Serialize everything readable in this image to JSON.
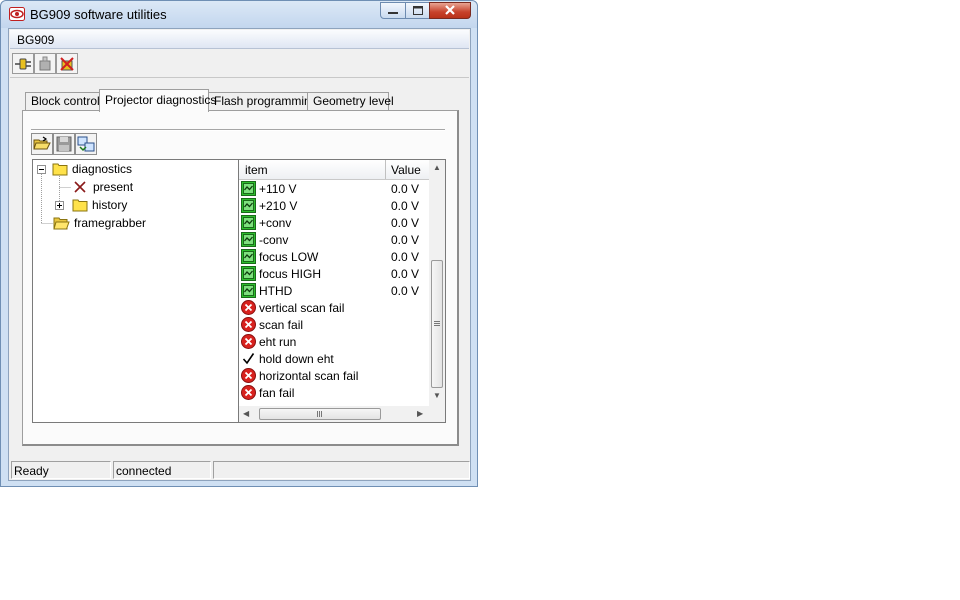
{
  "window": {
    "title": "BG909 software utilities",
    "doc_title": "BG909",
    "colors": {
      "title_gradient_top": "#dbe8f6",
      "close_button": "#c7422b",
      "folder": "#ffe24a",
      "status_ok": "#2dbd2d",
      "status_fail": "#d8221e"
    }
  },
  "toolbar": {
    "buttons": [
      {
        "icon": "connect-plug-icon"
      },
      {
        "icon": "device-disabled-icon"
      },
      {
        "icon": "device-delete-icon"
      }
    ]
  },
  "tabs": [
    {
      "label": "Block control",
      "active": false
    },
    {
      "label": "Projector diagnostics",
      "active": true
    },
    {
      "label": "Flash programming",
      "active": false
    },
    {
      "label": "Geometry level",
      "active": false
    }
  ],
  "panel_toolbar": {
    "buttons": [
      {
        "icon": "open-folder-icon"
      },
      {
        "icon": "save-disk-icon"
      },
      {
        "icon": "refresh-list-icon"
      }
    ]
  },
  "tree": {
    "nodes": [
      {
        "label": "diagnostics",
        "icon": "folder-icon",
        "expanded": true
      },
      {
        "label": "present",
        "icon": "red-x-icon"
      },
      {
        "label": "history",
        "icon": "folder-icon",
        "expanded": false
      },
      {
        "label": "framegrabber",
        "icon": "open-folder-icon"
      }
    ]
  },
  "list": {
    "columns": [
      "item",
      "Value"
    ],
    "rows": [
      {
        "name": "+110 V",
        "value": "0.0 V",
        "icon": "ok"
      },
      {
        "name": "+210 V",
        "value": "0.0 V",
        "icon": "ok"
      },
      {
        "name": "+conv",
        "value": "0.0 V",
        "icon": "ok"
      },
      {
        "name": "-conv",
        "value": "0.0 V",
        "icon": "ok"
      },
      {
        "name": "focus LOW",
        "value": "0.0 V",
        "icon": "ok"
      },
      {
        "name": "focus HIGH",
        "value": "0.0 V",
        "icon": "ok"
      },
      {
        "name": "HTHD",
        "value": "0.0 V",
        "icon": "ok"
      },
      {
        "name": "vertical scan fail",
        "value": "",
        "icon": "fail"
      },
      {
        "name": "scan fail",
        "value": "",
        "icon": "fail"
      },
      {
        "name": "eht run",
        "value": "",
        "icon": "fail"
      },
      {
        "name": "hold down eht",
        "value": "",
        "icon": "check"
      },
      {
        "name": "horizontal scan fail",
        "value": "",
        "icon": "fail"
      },
      {
        "name": "fan fail",
        "value": "",
        "icon": "fail"
      }
    ]
  },
  "status": {
    "state": "Ready",
    "connection": "connected",
    "extra": ""
  }
}
